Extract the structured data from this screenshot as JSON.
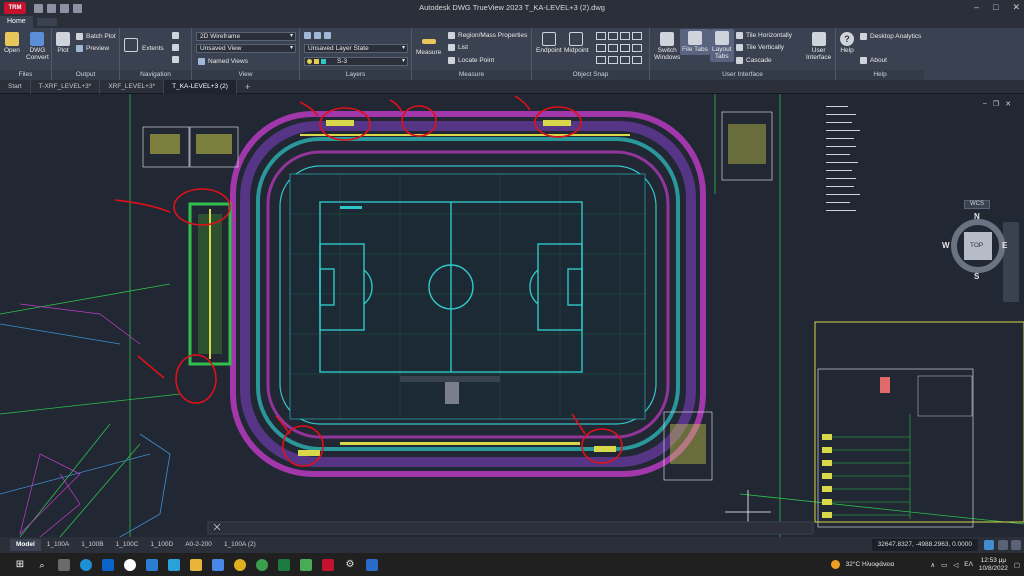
{
  "app": {
    "logo_label": "TRM",
    "window_title": "Autodesk DWG TrueView 2023   T_KA-LEVEL+3 (2).dwg"
  },
  "ribbon_tabs": [
    {
      "label": "Home"
    }
  ],
  "ribbon": {
    "files": {
      "title": "Files",
      "open": "Open",
      "dwg_convert": "DWG\nConvert"
    },
    "output": {
      "title": "Output",
      "plot": "Plot",
      "batch_plot": "Batch Plot",
      "preview": "Preview"
    },
    "navigation": {
      "title": "Navigation",
      "extents": "Extents"
    },
    "view": {
      "title": "View",
      "visual_style": "2D Wireframe",
      "saved_view": "Unsaved View",
      "named_views": "Named Views"
    },
    "layers": {
      "title": "Layers",
      "layer_state": "Unsaved Layer State",
      "current_layer": "S-3"
    },
    "measure": {
      "title": "Measure",
      "measure": "Measure",
      "region_mass": "Region/Mass Properties",
      "list": "List",
      "locate_point": "Locate Point"
    },
    "object_snap": {
      "title": "Object Snap",
      "endpoint": "Endpoint",
      "midpoint": "Midpoint"
    },
    "user_interface": {
      "title": "User Interface",
      "switch_windows": "Switch\nWindows",
      "file_tabs": "File Tabs",
      "layout_tabs": "Layout\nTabs",
      "tile_horizontally": "Tile Horizontally",
      "tile_vertically": "Tile Vertically",
      "cascade": "Cascade",
      "user_interface": "User\nInterface"
    },
    "help": {
      "title": "Help",
      "help": "Help",
      "desktop_analytics": "Desktop Analytics",
      "about": "About"
    }
  },
  "file_tabs": [
    {
      "label": "Start"
    },
    {
      "label": "T-XRF_LEVEL+3*"
    },
    {
      "label": "XRF_LEVEL+3*"
    },
    {
      "label": "T_KA-LEVEL+3 (2)"
    }
  ],
  "viewcube": {
    "n": "N",
    "s": "S",
    "e": "E",
    "w": "W",
    "top": "TOP",
    "wcs": "WCS"
  },
  "layout_tabs": [
    {
      "label": "Model"
    },
    {
      "label": "1_100A"
    },
    {
      "label": "1_100B"
    },
    {
      "label": "1_100C"
    },
    {
      "label": "1_100D"
    },
    {
      "label": "A0-2-200"
    },
    {
      "label": "1_100A (2)"
    }
  ],
  "status": {
    "coordinates": "32647.8327, -4988.2963, 0.0000"
  },
  "taskbar": {
    "weather": "32°C  Ηλιοφάνεια",
    "lang": "ΕΛ",
    "time": "12:53 μμ",
    "date": "10/8/2022"
  },
  "colors": {
    "accent": "#c4122f",
    "magenta": "#c23cc8",
    "cyan": "#2fc7c7",
    "green": "#2fbf4a",
    "yellow": "#d8d84a",
    "red_annotation": "#e0101a"
  }
}
